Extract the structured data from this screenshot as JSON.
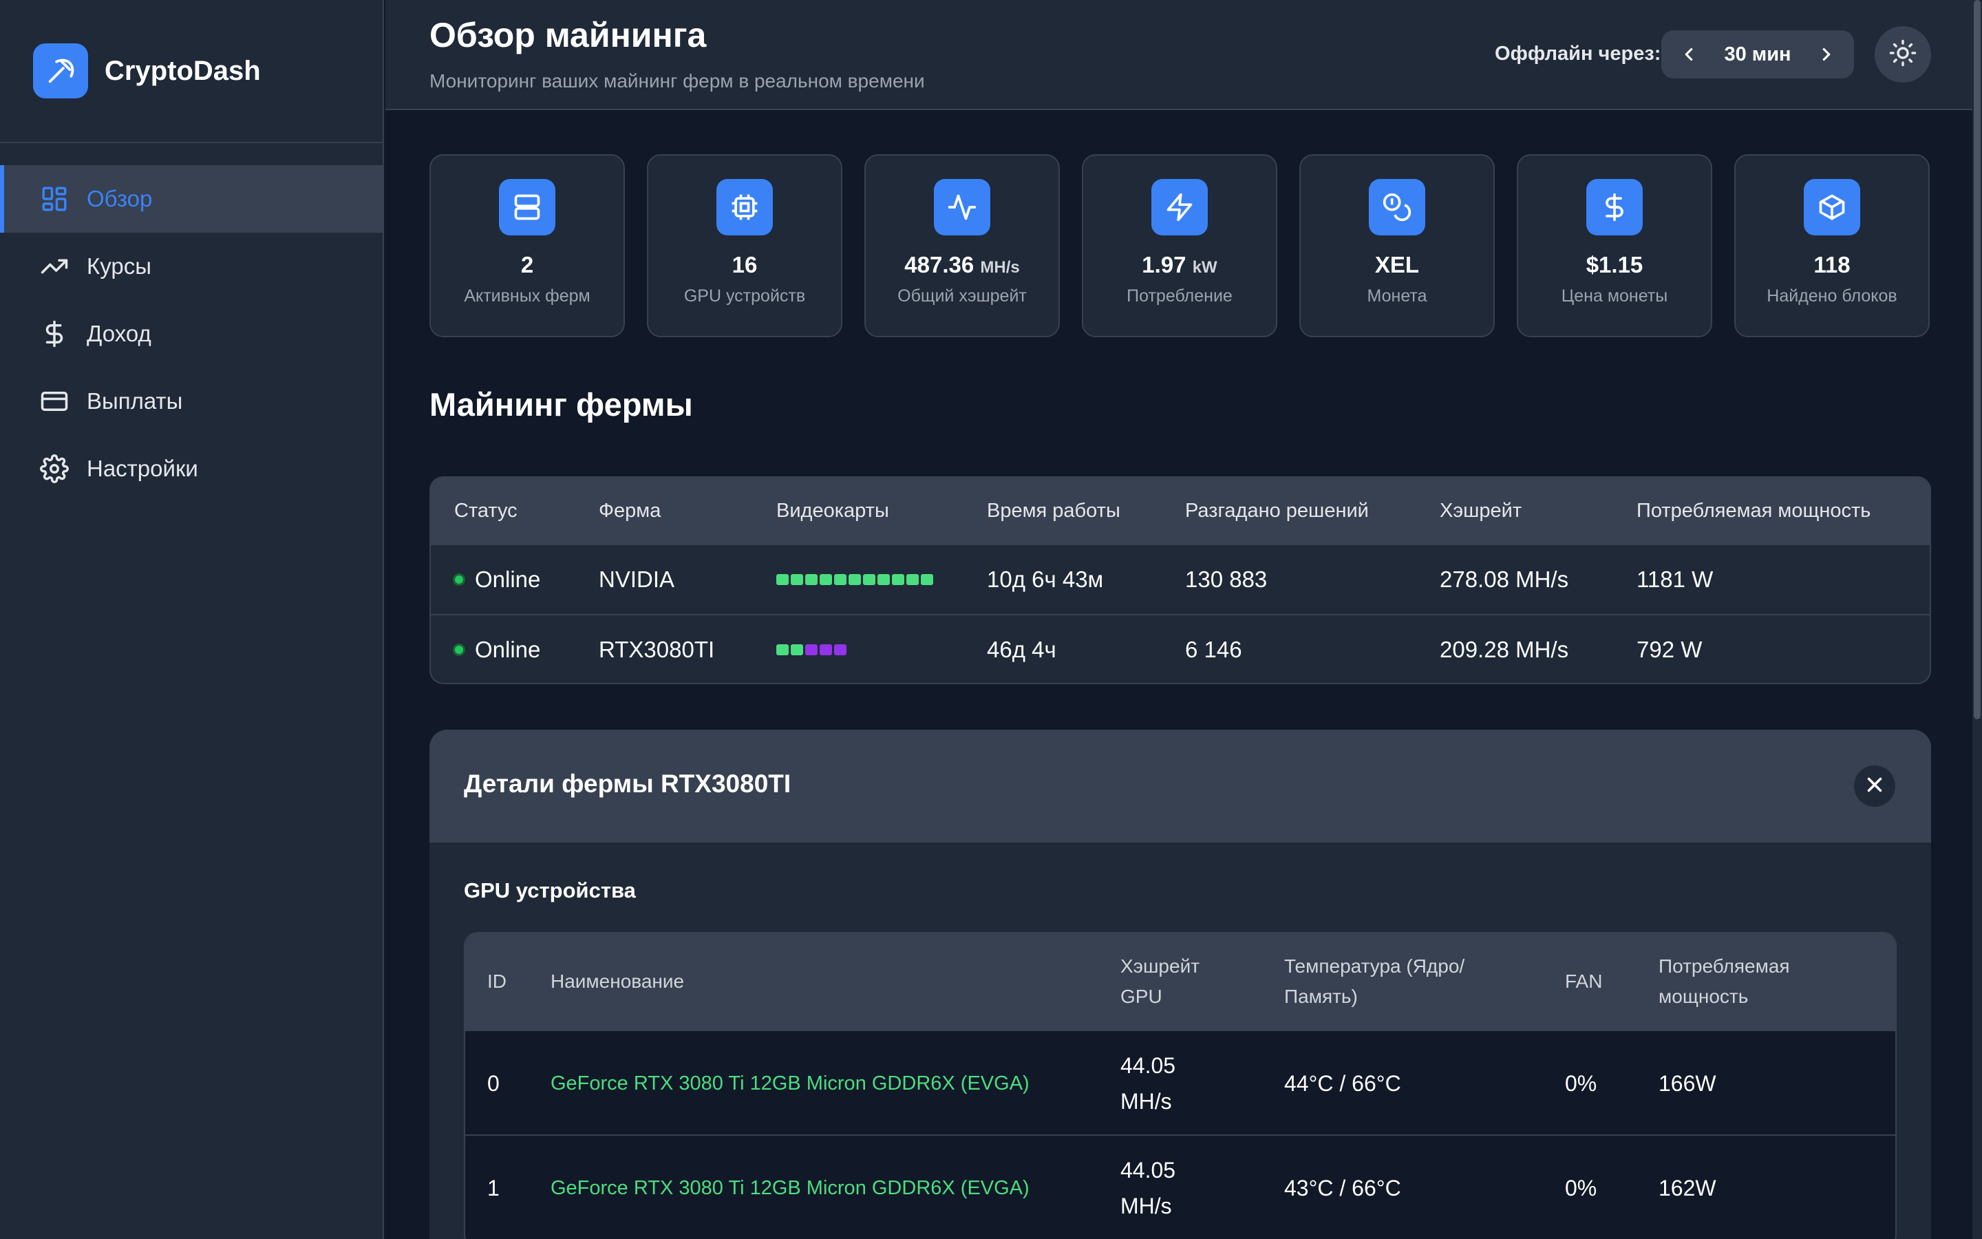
{
  "app": {
    "name": "CryptoDash"
  },
  "sidebar": {
    "items": [
      {
        "label": "Обзор",
        "icon": "grid-icon"
      },
      {
        "label": "Курсы",
        "icon": "trending-up-icon"
      },
      {
        "label": "Доход",
        "icon": "dollar-icon"
      },
      {
        "label": "Выплаты",
        "icon": "card-icon"
      },
      {
        "label": "Настройки",
        "icon": "gear-icon"
      }
    ]
  },
  "header": {
    "title": "Обзор майнинга",
    "subtitle": "Мониторинг ваших майнинг ферм в реальном времени",
    "offline_label": "Оффлайн через:",
    "offline_value": "30 мин"
  },
  "stats": [
    {
      "value": "2",
      "unit": "",
      "label": "Активных ферм",
      "icon": "server-icon"
    },
    {
      "value": "16",
      "unit": "",
      "label": "GPU устройств",
      "icon": "chip-icon"
    },
    {
      "value": "487.36",
      "unit": "MH/s",
      "label": "Общий хэшрейт",
      "icon": "activity-icon"
    },
    {
      "value": "1.97",
      "unit": "kW",
      "label": "Потребление",
      "icon": "bolt-icon"
    },
    {
      "value": "XEL",
      "unit": "",
      "label": "Монета",
      "icon": "coins-icon"
    },
    {
      "value": "$1.15",
      "unit": "",
      "label": "Цена монеты",
      "icon": "dollar-icon"
    },
    {
      "value": "118",
      "unit": "",
      "label": "Найдено блоков",
      "icon": "cube-icon"
    }
  ],
  "farms": {
    "title": "Майнинг фермы",
    "headers": [
      "Статус",
      "Ферма",
      "Видеокарты",
      "Время работы",
      "Разгадано решений",
      "Хэшрейт",
      "Потребляемая мощность"
    ],
    "rows": [
      {
        "status": "Online",
        "farm": "NVIDIA",
        "uptime": "10д 6ч 43м",
        "solutions": "130 883",
        "hashrate": "278.08 MH/s",
        "power": "1181 W",
        "gpus": [
          "#4ade80",
          "#4ade80",
          "#4ade80",
          "#4ade80",
          "#4ade80",
          "#4ade80",
          "#4ade80",
          "#4ade80",
          "#4ade80",
          "#4ade80",
          "#4ade80"
        ]
      },
      {
        "status": "Online",
        "farm": "RTX3080TI",
        "uptime": "46д 4ч",
        "solutions": "6 146",
        "hashrate": "209.28 MH/s",
        "power": "792 W",
        "gpus": [
          "#4ade80",
          "#4ade80",
          "#9333ea",
          "#9333ea",
          "#9333ea"
        ]
      }
    ]
  },
  "details": {
    "title": "Детали фермы RTX3080TI",
    "gpu_section_title": "GPU устройства",
    "headers": {
      "id": "ID",
      "name": "Наименование",
      "hashrate_l1": "Хэшрейт",
      "hashrate_l2": "GPU",
      "temp_l1": "Температура (Ядро/",
      "temp_l2": "Память)",
      "fan": "FAN",
      "power_l1": "Потребляемая",
      "power_l2": "мощность"
    },
    "rows": [
      {
        "id": "0",
        "name": "GeForce RTX 3080 Ti 12GB Micron GDDR6X (EVGA)",
        "hash_l1": "44.05",
        "hash_l2": "MH/s",
        "temp": "44°C / 66°C",
        "fan": "0%",
        "power": "166W"
      },
      {
        "id": "1",
        "name": "GeForce RTX 3080 Ti 12GB Micron GDDR6X (EVGA)",
        "hash_l1": "44.05",
        "hash_l2": "MH/s",
        "temp": "43°C / 66°C",
        "fan": "0%",
        "power": "162W"
      }
    ]
  },
  "colors": {
    "accent": "#3b82f6",
    "online": "#22c55e",
    "gpu_ok": "#4ade80",
    "gpu_warn": "#9333ea"
  }
}
